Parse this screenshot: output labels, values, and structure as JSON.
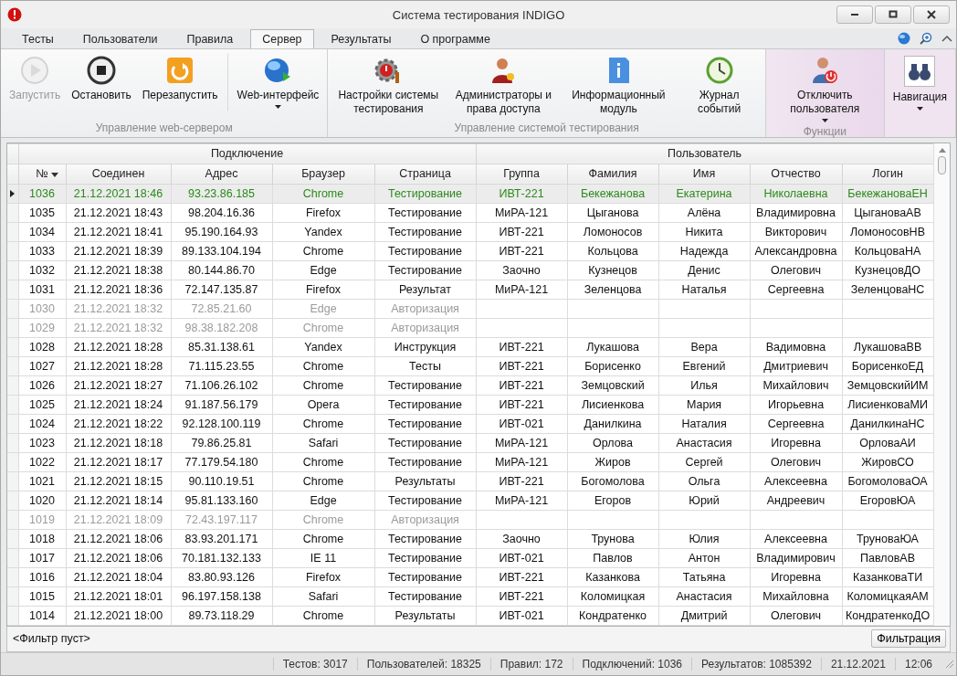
{
  "window": {
    "title": "Система тестирования INDIGO"
  },
  "tabs": [
    {
      "label": "Тесты",
      "selected": false
    },
    {
      "label": "Пользователи",
      "selected": false
    },
    {
      "label": "Правила",
      "selected": false
    },
    {
      "label": "Сервер",
      "selected": true
    },
    {
      "label": "Результаты",
      "selected": false
    },
    {
      "label": "О программе",
      "selected": false
    }
  ],
  "ribbon_groups": [
    {
      "label": "Управление web-сервером",
      "buttons": [
        {
          "label": "Запустить",
          "disabled": true,
          "dropdown": false
        },
        {
          "label": "Остановить",
          "disabled": false,
          "dropdown": false
        },
        {
          "label": "Перезапустить",
          "disabled": false,
          "dropdown": false
        },
        {
          "label": "Web-интерфейс",
          "disabled": false,
          "dropdown": true
        }
      ]
    },
    {
      "label": "Управление системой тестирования",
      "buttons": [
        {
          "label": "Настройки системы тестирования",
          "disabled": false,
          "dropdown": false
        },
        {
          "label": "Администраторы и права доступа",
          "disabled": false,
          "dropdown": false
        },
        {
          "label": "Информационный модуль",
          "disabled": false,
          "dropdown": false
        },
        {
          "label": "Журнал событий",
          "disabled": false,
          "dropdown": false
        }
      ]
    },
    {
      "label": "Функции",
      "buttons": [
        {
          "label": "Отключить пользователя",
          "disabled": false,
          "dropdown": true
        }
      ]
    },
    {
      "buttons": [
        {
          "label": "Навигация",
          "disabled": false,
          "dropdown": true
        }
      ]
    }
  ],
  "table": {
    "groups": [
      "Подключение",
      "Пользователь"
    ],
    "columns": [
      {
        "label": "№",
        "sorted": true
      },
      {
        "label": "Соединен",
        "sorted": false
      },
      {
        "label": "Адрес",
        "sorted": false
      },
      {
        "label": "Браузер",
        "sorted": false
      },
      {
        "label": "Страница",
        "sorted": false
      },
      {
        "label": "Группа",
        "sorted": false
      },
      {
        "label": "Фамилия",
        "sorted": false
      },
      {
        "label": "Имя",
        "sorted": false
      },
      {
        "label": "Отчество",
        "sorted": false
      },
      {
        "label": "Логин",
        "sorted": false
      }
    ],
    "rows": [
      {
        "selected": true,
        "kind": "user",
        "cells": [
          "1036",
          "21.12.2021 18:46",
          "93.23.86.185",
          "Chrome",
          "Тестирование",
          "ИВТ-221",
          "Бекежанова",
          "Екатерина",
          "Николаевна",
          "БекежановаЕН"
        ]
      },
      {
        "selected": false,
        "kind": "user",
        "cells": [
          "1035",
          "21.12.2021 18:43",
          "98.204.16.36",
          "Firefox",
          "Тестирование",
          "МиРА-121",
          "Цыганова",
          "Алёна",
          "Владимировна",
          "ЦыгановаАВ"
        ]
      },
      {
        "selected": false,
        "kind": "user",
        "cells": [
          "1034",
          "21.12.2021 18:41",
          "95.190.164.93",
          "Yandex",
          "Тестирование",
          "ИВТ-221",
          "Ломоносов",
          "Никита",
          "Викторович",
          "ЛомоносовНВ"
        ]
      },
      {
        "selected": false,
        "kind": "user",
        "cells": [
          "1033",
          "21.12.2021 18:39",
          "89.133.104.194",
          "Chrome",
          "Тестирование",
          "ИВТ-221",
          "Кольцова",
          "Надежда",
          "Александровна",
          "КольцоваНА"
        ]
      },
      {
        "selected": false,
        "kind": "user",
        "cells": [
          "1032",
          "21.12.2021 18:38",
          "80.144.86.70",
          "Edge",
          "Тестирование",
          "Заочно",
          "Кузнецов",
          "Денис",
          "Олегович",
          "КузнецовДО"
        ]
      },
      {
        "selected": false,
        "kind": "user",
        "cells": [
          "1031",
          "21.12.2021 18:36",
          "72.147.135.87",
          "Firefox",
          "Результат",
          "МиРА-121",
          "Зеленцова",
          "Наталья",
          "Сергеевна",
          "ЗеленцоваНС"
        ]
      },
      {
        "selected": false,
        "kind": "guest",
        "cells": [
          "1030",
          "21.12.2021 18:32",
          "72.85.21.60",
          "Edge",
          "Авторизация"
        ]
      },
      {
        "selected": false,
        "kind": "guest",
        "cells": [
          "1029",
          "21.12.2021 18:32",
          "98.38.182.208",
          "Chrome",
          "Авторизация"
        ]
      },
      {
        "selected": false,
        "kind": "user",
        "cells": [
          "1028",
          "21.12.2021 18:28",
          "85.31.138.61",
          "Yandex",
          "Инструкция",
          "ИВТ-221",
          "Лукашова",
          "Вера",
          "Вадимовна",
          "ЛукашоваВВ"
        ]
      },
      {
        "selected": false,
        "kind": "user",
        "cells": [
          "1027",
          "21.12.2021 18:28",
          "71.115.23.55",
          "Chrome",
          "Тесты",
          "ИВТ-221",
          "Борисенко",
          "Евгений",
          "Дмитриевич",
          "БорисенкоЕД"
        ]
      },
      {
        "selected": false,
        "kind": "user",
        "cells": [
          "1026",
          "21.12.2021 18:27",
          "71.106.26.102",
          "Chrome",
          "Тестирование",
          "ИВТ-221",
          "Земцовский",
          "Илья",
          "Михайлович",
          "ЗемцовскийИМ"
        ]
      },
      {
        "selected": false,
        "kind": "user",
        "cells": [
          "1025",
          "21.12.2021 18:24",
          "91.187.56.179",
          "Opera",
          "Тестирование",
          "ИВТ-221",
          "Лисиенкова",
          "Мария",
          "Игорьевна",
          "ЛисиенковаМИ"
        ]
      },
      {
        "selected": false,
        "kind": "user",
        "cells": [
          "1024",
          "21.12.2021 18:22",
          "92.128.100.119",
          "Chrome",
          "Тестирование",
          "ИВТ-021",
          "Данилкина",
          "Наталия",
          "Сергеевна",
          "ДанилкинаНС"
        ]
      },
      {
        "selected": false,
        "kind": "user",
        "cells": [
          "1023",
          "21.12.2021 18:18",
          "79.86.25.81",
          "Safari",
          "Тестирование",
          "МиРА-121",
          "Орлова",
          "Анастасия",
          "Игоревна",
          "ОрловаАИ"
        ]
      },
      {
        "selected": false,
        "kind": "user",
        "cells": [
          "1022",
          "21.12.2021 18:17",
          "77.179.54.180",
          "Chrome",
          "Тестирование",
          "МиРА-121",
          "Жиров",
          "Сергей",
          "Олегович",
          "ЖировСО"
        ]
      },
      {
        "selected": false,
        "kind": "user",
        "cells": [
          "1021",
          "21.12.2021 18:15",
          "90.110.19.51",
          "Chrome",
          "Результаты",
          "ИВТ-221",
          "Богомолова",
          "Ольга",
          "Алексеевна",
          "БогомоловаОА"
        ]
      },
      {
        "selected": false,
        "kind": "user",
        "cells": [
          "1020",
          "21.12.2021 18:14",
          "95.81.133.160",
          "Edge",
          "Тестирование",
          "МиРА-121",
          "Егоров",
          "Юрий",
          "Андреевич",
          "ЕгоровЮА"
        ]
      },
      {
        "selected": false,
        "kind": "guest",
        "cells": [
          "1019",
          "21.12.2021 18:09",
          "72.43.197.117",
          "Chrome",
          "Авторизация"
        ]
      },
      {
        "selected": false,
        "kind": "user",
        "cells": [
          "1018",
          "21.12.2021 18:06",
          "83.93.201.171",
          "Chrome",
          "Тестирование",
          "Заочно",
          "Трунова",
          "Юлия",
          "Алексеевна",
          "ТруноваЮА"
        ]
      },
      {
        "selected": false,
        "kind": "user",
        "cells": [
          "1017",
          "21.12.2021 18:06",
          "70.181.132.133",
          "IE 11",
          "Тестирование",
          "ИВТ-021",
          "Павлов",
          "Антон",
          "Владимирович",
          "ПавловАВ"
        ]
      },
      {
        "selected": false,
        "kind": "user",
        "cells": [
          "1016",
          "21.12.2021 18:04",
          "83.80.93.126",
          "Firefox",
          "Тестирование",
          "ИВТ-221",
          "Казанкова",
          "Татьяна",
          "Игоревна",
          "КазанковаТИ"
        ]
      },
      {
        "selected": false,
        "kind": "user",
        "cells": [
          "1015",
          "21.12.2021 18:01",
          "96.197.158.138",
          "Safari",
          "Тестирование",
          "ИВТ-221",
          "Коломицкая",
          "Анастасия",
          "Михайловна",
          "КоломицкаяАМ"
        ]
      },
      {
        "selected": false,
        "kind": "user",
        "cells": [
          "1014",
          "21.12.2021 18:00",
          "89.73.118.29",
          "Chrome",
          "Результаты",
          "ИВТ-021",
          "Кондратенко",
          "Дмитрий",
          "Олегович",
          "КондратенкоДО"
        ]
      }
    ]
  },
  "filter": {
    "text": "<Фильтр пуст>",
    "button": "Фильтрация"
  },
  "status_bar": [
    "Тестов: 3017",
    "Пользователей: 18325",
    "Правил: 172",
    "Подключений: 1036",
    "Результатов: 1085392",
    "21.12.2021",
    "12:06"
  ]
}
